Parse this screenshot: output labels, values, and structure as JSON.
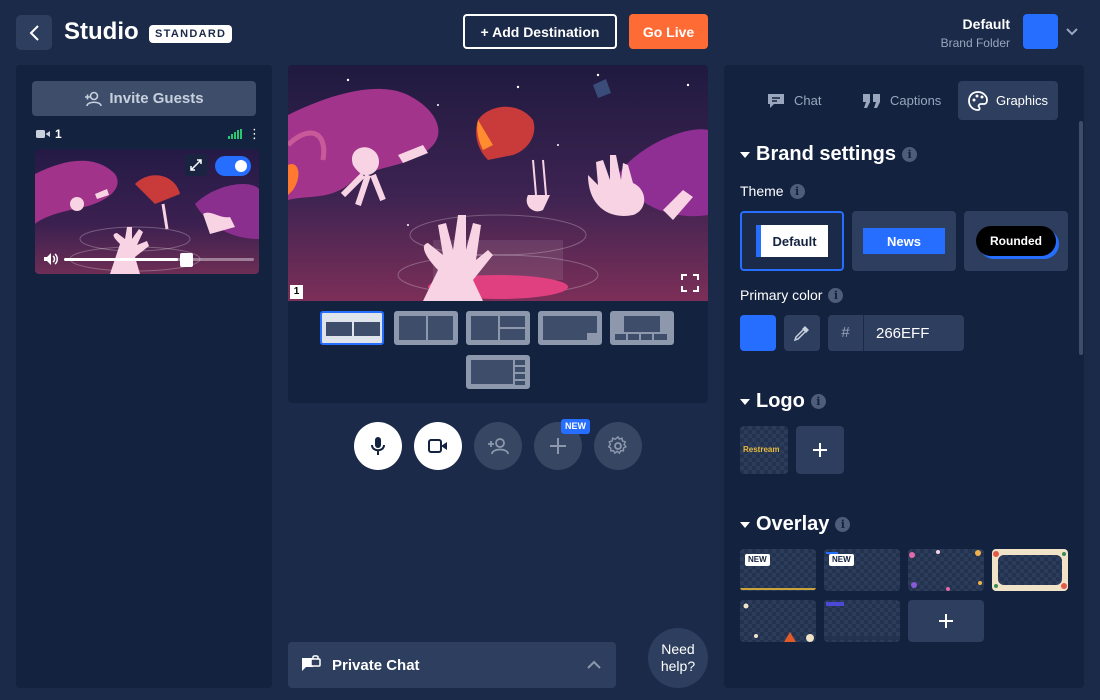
{
  "header": {
    "title": "Studio",
    "plan_badge": "STANDARD",
    "add_destination": "+ Add Destination",
    "go_live": "Go Live",
    "brand_name": "Default",
    "brand_sub": "Brand Folder",
    "brand_color": "#266EFF"
  },
  "left": {
    "invite_label": "Invite Guests",
    "camera_count": "1",
    "toggle_on": true,
    "volume_level": 0.6
  },
  "stage": {
    "participant_number": "1",
    "layouts": [
      "two-up",
      "split",
      "main-side",
      "picture-in-picture",
      "main-strip",
      "main-sidebar"
    ],
    "active_layout": 0
  },
  "controls": {
    "new_badge": "NEW",
    "items": [
      "microphone-icon",
      "camera-icon",
      "add-guest-icon",
      "add-source-icon",
      "settings-icon"
    ]
  },
  "private_chat": {
    "label": "Private Chat"
  },
  "help": {
    "line1": "Need",
    "line2": "help?"
  },
  "right": {
    "tabs": [
      {
        "label": "Chat",
        "icon": "chat-icon"
      },
      {
        "label": "Captions",
        "icon": "captions-icon"
      },
      {
        "label": "Graphics",
        "icon": "palette-icon"
      }
    ],
    "active_tab": 2,
    "brand_settings": {
      "title": "Brand settings",
      "theme_label": "Theme",
      "themes": [
        "Default",
        "News",
        "Rounded"
      ],
      "active_theme": 0,
      "primary_color_label": "Primary color",
      "primary_color_hash": "#",
      "primary_color": "266EFF"
    },
    "logo": {
      "title": "Logo",
      "logo_text": "Restream"
    },
    "overlay": {
      "title": "Overlay",
      "new_tag": "NEW"
    }
  },
  "colors": {
    "accent": "#266EFF",
    "go_live": "#FF6B35",
    "bg": "#1B2A48",
    "panel": "#13223F"
  }
}
